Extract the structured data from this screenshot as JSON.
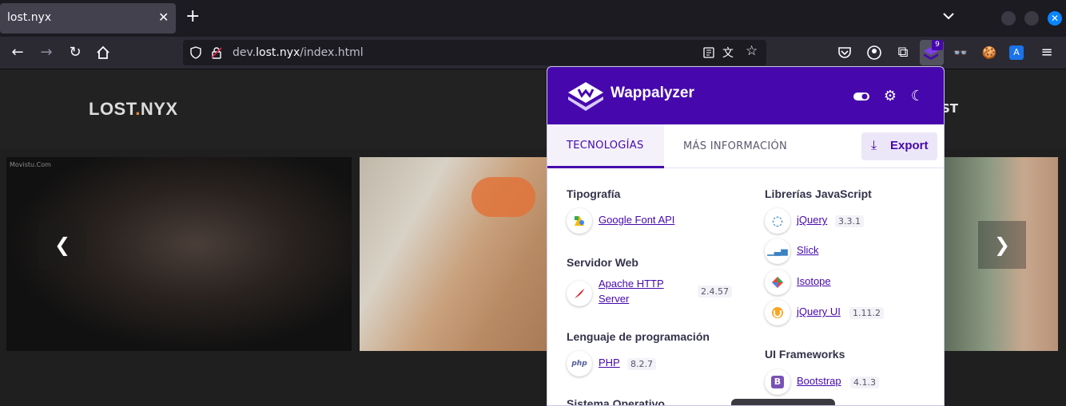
{
  "browser": {
    "tab_title": "lost.nyx",
    "tab_close": "✕",
    "new_tab": "+",
    "url_prefix": "dev.",
    "url_host": "lost.nyx",
    "url_path": "/index.html",
    "extension_badge": "9"
  },
  "site": {
    "logo_left": "LOST",
    "logo_dot": ".",
    "logo_right": "NYX",
    "nav_fragment": "ST",
    "watermark": "Movistu.Com",
    "prev": "❮",
    "next": "❯"
  },
  "wappalyzer": {
    "brand": "Wappalyzer",
    "tabs": {
      "tech": "TECNOLOGÍAS",
      "more": "MÁS INFORMACIÓN"
    },
    "export_label": "Export",
    "left_column": [
      {
        "category": "Tipografía",
        "items": [
          {
            "name": "Google Font API",
            "version": ""
          }
        ]
      },
      {
        "category": "Servidor Web",
        "items": [
          {
            "name_line1": "Apache HTTP",
            "name_line2": "Server",
            "version": "2.4.57"
          }
        ]
      },
      {
        "category": "Lenguaje de programación",
        "items": [
          {
            "name": "PHP",
            "version": "8.2.7"
          }
        ]
      },
      {
        "category": "Sistema Operativo",
        "items": []
      }
    ],
    "right_column": [
      {
        "category": "Librerías JavaScript",
        "items": [
          {
            "name": "jQuery",
            "version": "3.3.1"
          },
          {
            "name": "Slick",
            "version": ""
          },
          {
            "name": "Isotope",
            "version": ""
          },
          {
            "name": "jQuery UI",
            "version": "1.11.2"
          }
        ]
      },
      {
        "category": "UI Frameworks",
        "items": [
          {
            "name": "Bootstrap",
            "version": "4.1.3"
          }
        ]
      }
    ]
  },
  "colors": {
    "accent": "#4608ad",
    "logo_dot": "#f68b2c",
    "firefox_blue": "#0a84ff"
  }
}
